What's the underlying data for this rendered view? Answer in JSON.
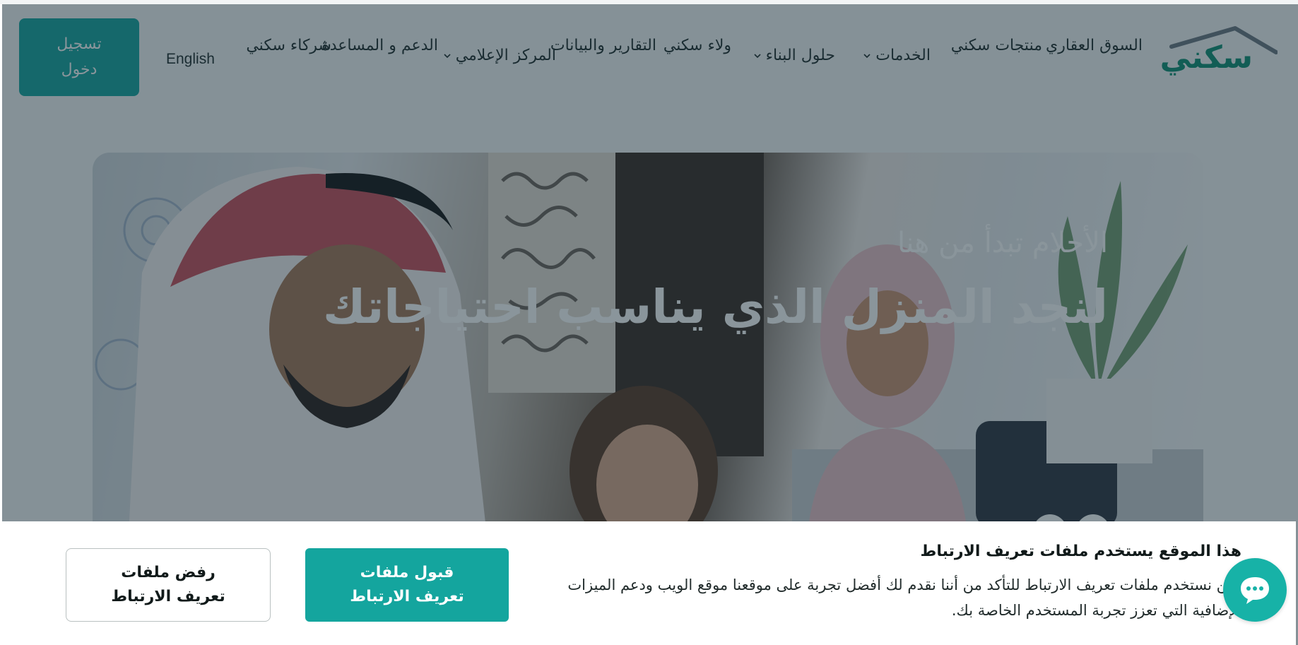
{
  "header": {
    "logo_text": "سكني",
    "nav": {
      "real_estate_market": "السوق العقاري",
      "sakani_products": "منتجات سكني",
      "services": "الخدمات",
      "building_solutions": "حلول البناء",
      "sakani_loyalty": "ولاء سكني",
      "reports_data": "التقارير والبيانات",
      "media_center": "المركز الإعلامي",
      "support_help": "الدعم و المساعدة",
      "sakani_partners": "شركاء سكني"
    },
    "language": "English",
    "login": "تسجيل دخول"
  },
  "hero": {
    "subtitle": "الأحلام تبدأ من هنا",
    "title": "لنجد المنزل الذي يناسب احتياجاتك"
  },
  "cookie": {
    "title": "هذا الموقع يستخدم ملفات تعريف الارتباط",
    "text": "نحن نستخدم ملفات تعريف الارتباط للتأكد من أننا نقدم لك أفضل تجربة على موقعنا موقع الويب ودعم الميزات الإضافية التي تعزز تجربة المستخدم الخاصة بك.",
    "accept": "قبول ملفات تعريف الارتباط",
    "reject": "رفض ملفات تعريف الارتباط"
  },
  "icons": {
    "chat": "chat-bubble-icon",
    "chevron": "chevron-down-icon",
    "prev": "chevron-left-icon",
    "next": "chevron-right-icon"
  },
  "colors": {
    "brand_teal": "#14a59e",
    "logo_green": "#0f8f73",
    "logo_roof": "#6b7680"
  }
}
